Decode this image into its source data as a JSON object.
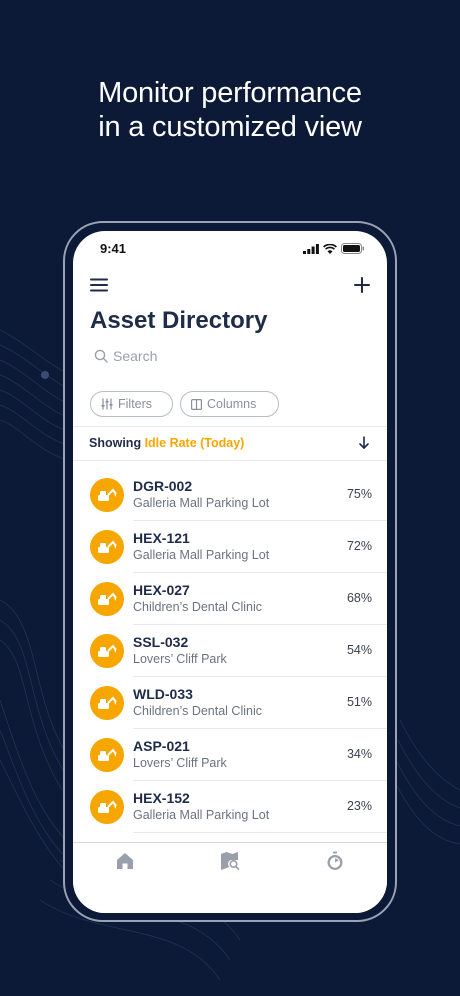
{
  "headline": {
    "line1": "Monitor performance",
    "line2": "in a customized view"
  },
  "status_bar": {
    "time": "9:41",
    "icons": [
      "cellular-signal-icon",
      "wifi-icon",
      "battery-icon"
    ]
  },
  "header": {
    "menu_icon": "hamburger-menu-icon",
    "add_icon": "plus-icon",
    "title": "Asset Directory"
  },
  "search": {
    "placeholder": "Search",
    "icon": "search-icon"
  },
  "toolbar": {
    "filters_label": "Filters",
    "columns_label": "Columns"
  },
  "showing": {
    "prefix": "Showing",
    "metric": "Idle Rate (Today)",
    "sort_icon": "arrow-down-icon"
  },
  "colors": {
    "background": "#0c1a38",
    "accent": "#f7a600",
    "title": "#1e2c4a"
  },
  "assets": [
    {
      "id": "DGR-002",
      "location": "Galleria Mall Parking Lot",
      "value": "75%"
    },
    {
      "id": "HEX-121",
      "location": "Galleria Mall Parking Lot",
      "value": "72%"
    },
    {
      "id": "HEX-027",
      "location": "Children’s Dental Clinic",
      "value": "68%"
    },
    {
      "id": "SSL-032",
      "location": "Lovers’ Cliff Park",
      "value": "54%"
    },
    {
      "id": "WLD-033",
      "location": "Children’s Dental Clinic",
      "value": "51%"
    },
    {
      "id": "ASP-021",
      "location": "Lovers’ Cliff Park",
      "value": "34%"
    },
    {
      "id": "HEX-152",
      "location": "Galleria Mall Parking Lot",
      "value": "23%"
    }
  ],
  "tabbar": {
    "items": [
      "home-icon",
      "map-search-icon",
      "stopwatch-icon"
    ]
  }
}
